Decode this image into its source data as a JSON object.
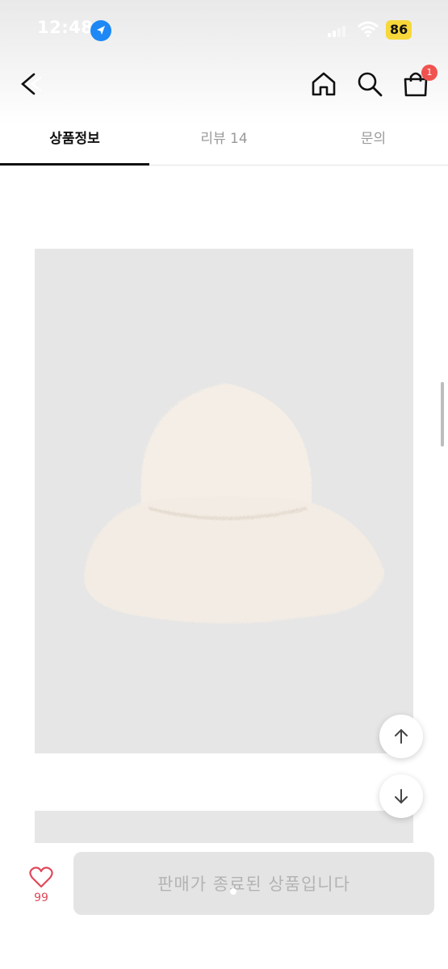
{
  "status_bar": {
    "time": "12:48",
    "battery": "86"
  },
  "header": {
    "back_icon": "back-icon",
    "home_icon": "home-icon",
    "search_icon": "search-icon",
    "cart_icon": "cart-icon",
    "cart_badge": "1"
  },
  "tabs": [
    {
      "label": "상품정보",
      "active": true
    },
    {
      "label": "리뷰 14",
      "active": false
    },
    {
      "label": "문의",
      "active": false
    }
  ],
  "product": {
    "image_icon": "bucket-hat-image",
    "image_color": "#e6e6e6",
    "hat_color": "#f5eee6"
  },
  "floating": {
    "scroll_up_icon": "arrow-up-icon",
    "scroll_down_icon": "arrow-down-icon"
  },
  "bottom_bar": {
    "like_icon": "heart-icon",
    "like_count": "99",
    "button_label": "판매가 종료된 상품입니다"
  },
  "colors": {
    "accent_red": "#e0485a",
    "badge_red": "#f0534f",
    "disabled_button": "#e4e4e4"
  }
}
